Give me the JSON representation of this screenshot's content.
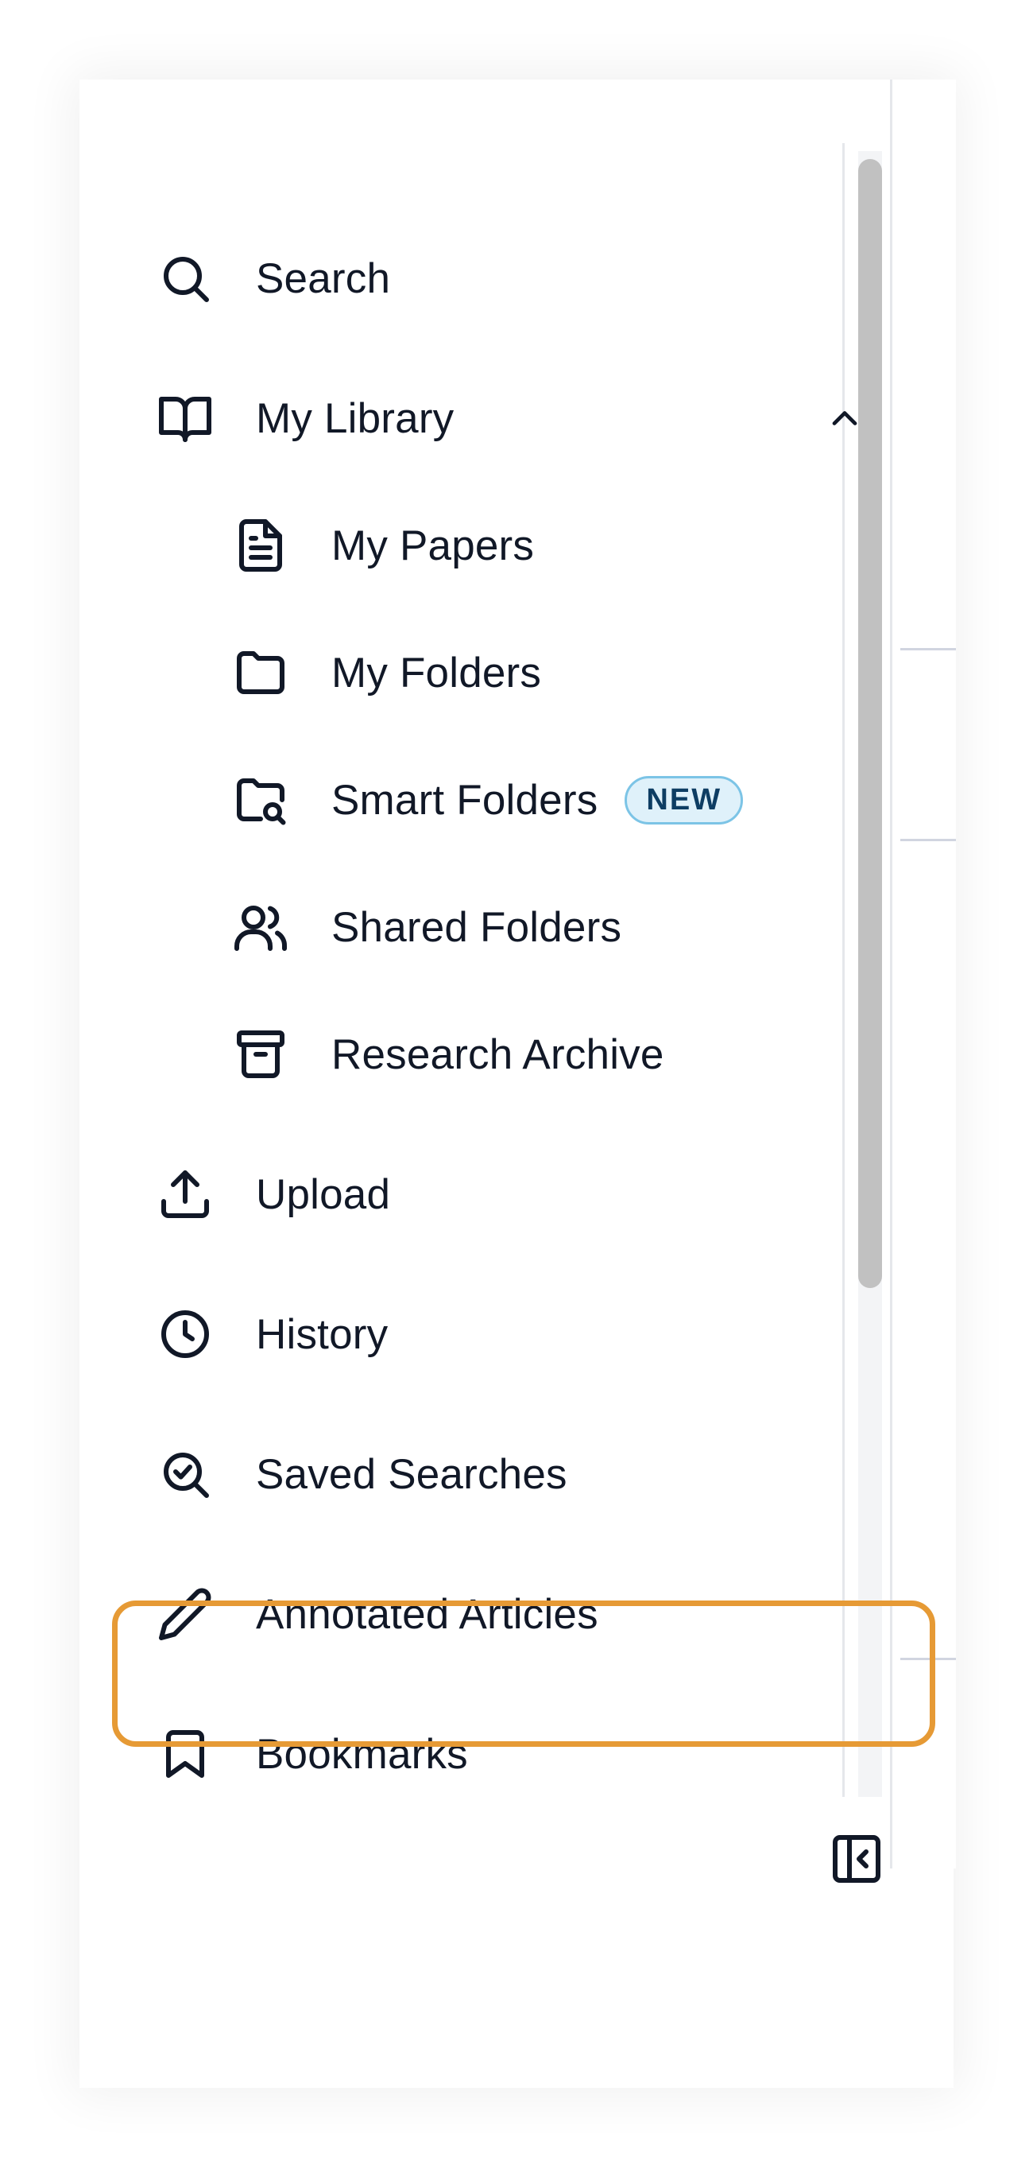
{
  "nav": {
    "search": {
      "label": "Search",
      "icon": "search-icon"
    },
    "my_library": {
      "label": "My Library",
      "icon": "book-open-icon",
      "expanded": true
    },
    "my_papers": {
      "label": "My Papers",
      "icon": "document-icon"
    },
    "my_folders": {
      "label": "My Folders",
      "icon": "folder-icon"
    },
    "smart_folders": {
      "label": "Smart Folders",
      "icon": "folder-search-icon",
      "badge": "NEW"
    },
    "shared_folders": {
      "label": "Shared Folders",
      "icon": "users-icon"
    },
    "research_archive": {
      "label": "Research Archive",
      "icon": "archive-icon"
    },
    "upload": {
      "label": "Upload",
      "icon": "upload-icon"
    },
    "history": {
      "label": "History",
      "icon": "clock-icon"
    },
    "saved_searches": {
      "label": "Saved Searches",
      "icon": "search-check-icon"
    },
    "annotated_articles": {
      "label": "Annotated Articles",
      "icon": "pencil-icon"
    },
    "bookmarks": {
      "label": "Bookmarks",
      "icon": "bookmark-icon",
      "highlighted": true
    }
  },
  "colors": {
    "highlight": "#e69a35",
    "badge_border": "#7cc4e6",
    "badge_bg": "#dff1fa",
    "badge_text": "#0d3d63",
    "text": "#111827"
  }
}
